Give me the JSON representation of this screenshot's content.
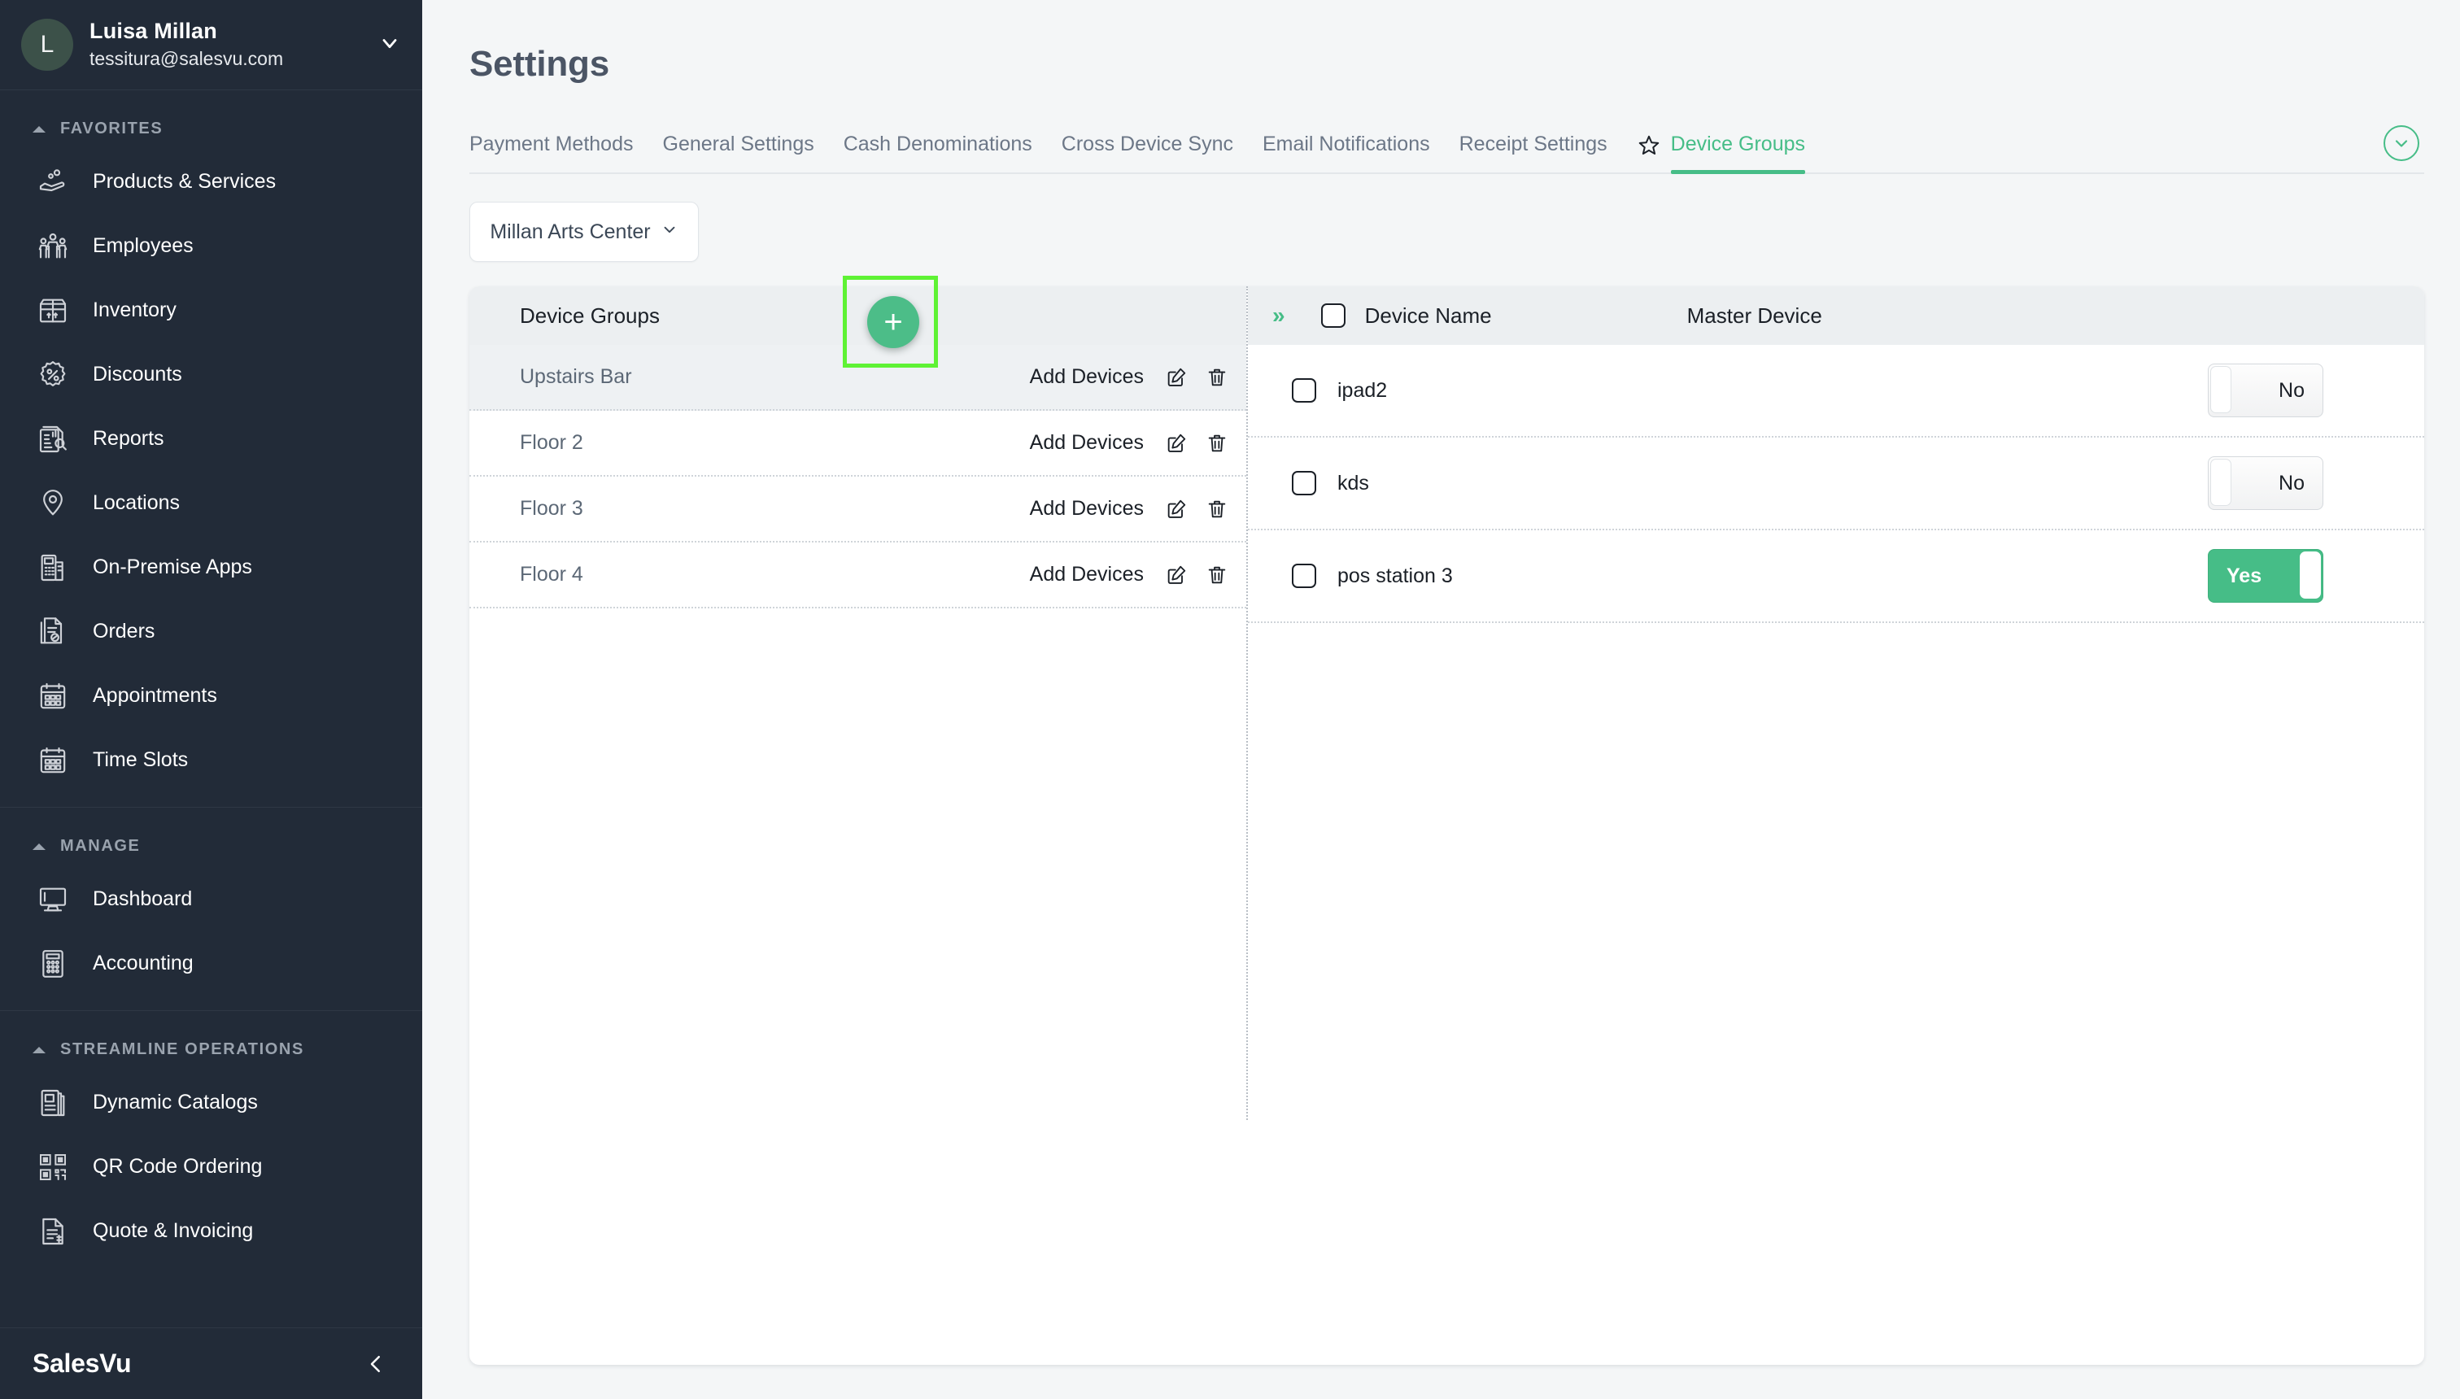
{
  "sidebar": {
    "user": {
      "initial": "L",
      "name": "Luisa Millan",
      "email": "tessitura@salesvu.com"
    },
    "groups": [
      {
        "label": "FAVORITES",
        "items": [
          {
            "label": "Products & Services",
            "icon": "products-services-icon"
          },
          {
            "label": "Employees",
            "icon": "employees-icon"
          },
          {
            "label": "Inventory",
            "icon": "inventory-icon"
          },
          {
            "label": "Discounts",
            "icon": "discounts-icon"
          },
          {
            "label": "Reports",
            "icon": "reports-icon"
          },
          {
            "label": "Locations",
            "icon": "locations-icon"
          },
          {
            "label": "On-Premise Apps",
            "icon": "on-premise-apps-icon"
          },
          {
            "label": "Orders",
            "icon": "orders-icon"
          },
          {
            "label": "Appointments",
            "icon": "appointments-icon"
          },
          {
            "label": "Time Slots",
            "icon": "time-slots-icon"
          }
        ]
      },
      {
        "label": "MANAGE",
        "items": [
          {
            "label": "Dashboard",
            "icon": "dashboard-icon"
          },
          {
            "label": "Accounting",
            "icon": "accounting-icon"
          }
        ]
      },
      {
        "label": "STREAMLINE OPERATIONS",
        "items": [
          {
            "label": "Dynamic Catalogs",
            "icon": "dynamic-catalogs-icon"
          },
          {
            "label": "QR Code Ordering",
            "icon": "qr-code-ordering-icon"
          },
          {
            "label": "Quote & Invoicing",
            "icon": "quote-invoicing-icon"
          }
        ]
      }
    ],
    "footer": {
      "logo": "SalesVu",
      "collapse_icon": "chevron-left-icon"
    }
  },
  "header": {
    "title": "Settings"
  },
  "tabs": [
    {
      "label": "Payment Methods",
      "active": false
    },
    {
      "label": "General Settings",
      "active": false
    },
    {
      "label": "Cash Denominations",
      "active": false
    },
    {
      "label": "Cross Device Sync",
      "active": false
    },
    {
      "label": "Email Notifications",
      "active": false
    },
    {
      "label": "Receipt Settings",
      "active": false
    },
    {
      "label": "Device Groups",
      "active": true
    }
  ],
  "tabbar": {
    "favorite_icon": "star-outline-icon",
    "expand_icon": "chevron-down-circle-icon"
  },
  "location_select": {
    "value": "Millan Arts Center",
    "caret_icon": "chevron-down-icon"
  },
  "device_groups_panel": {
    "title": "Device Groups",
    "add_button_label": "+",
    "rows": [
      {
        "name": "Upstairs Bar",
        "action": "Add Devices",
        "selected": true
      },
      {
        "name": "Floor 2",
        "action": "Add Devices",
        "selected": false
      },
      {
        "name": "Floor 3",
        "action": "Add Devices",
        "selected": false
      },
      {
        "name": "Floor 4",
        "action": "Add Devices",
        "selected": false
      }
    ]
  },
  "devices_panel": {
    "expand_icon": "double-chevron-right-icon",
    "columns": {
      "device_name": "Device Name",
      "master_device": "Master Device"
    },
    "rows": [
      {
        "name": "ipad2",
        "master": "No",
        "master_on": false,
        "checked": false
      },
      {
        "name": "kds",
        "master": "No",
        "master_on": false,
        "checked": false
      },
      {
        "name": "pos station  3",
        "master": "Yes",
        "master_on": true,
        "checked": false
      }
    ]
  },
  "colors": {
    "accent_green": "#46bd87",
    "sidebar_bg": "#222b38",
    "highlight_box": "#5ef234",
    "page_bg": "#f4f6f7"
  }
}
